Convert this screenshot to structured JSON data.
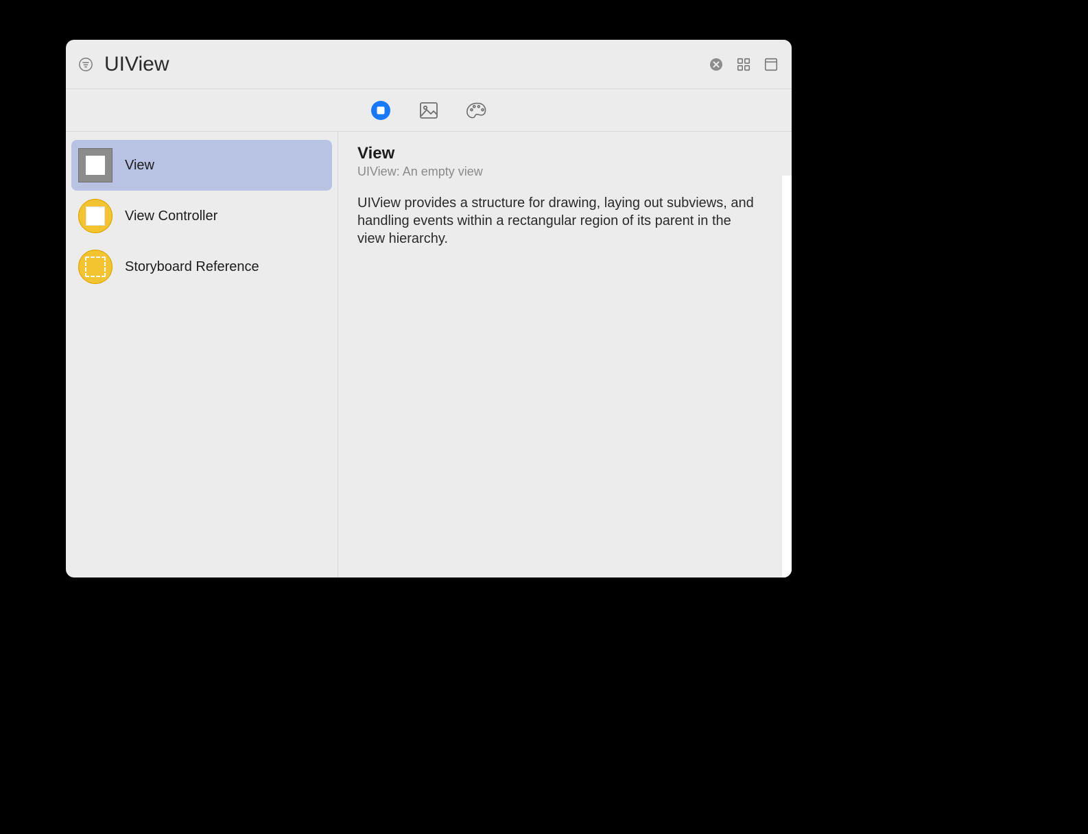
{
  "search": {
    "value": "UIView"
  },
  "tabs": {
    "active_index": 0,
    "items": [
      {
        "name": "objects"
      },
      {
        "name": "media"
      },
      {
        "name": "color"
      }
    ]
  },
  "results": {
    "selected_index": 0,
    "items": [
      {
        "label": "View",
        "icon": "view"
      },
      {
        "label": "View Controller",
        "icon": "view-controller"
      },
      {
        "label": "Storyboard Reference",
        "icon": "storyboard-reference"
      }
    ]
  },
  "detail": {
    "title": "View",
    "subtitle": "UIView: An empty view",
    "description": "UIView provides a structure for drawing, laying out subviews, and handling events within a rectangular region of its parent in the view hierarchy."
  }
}
